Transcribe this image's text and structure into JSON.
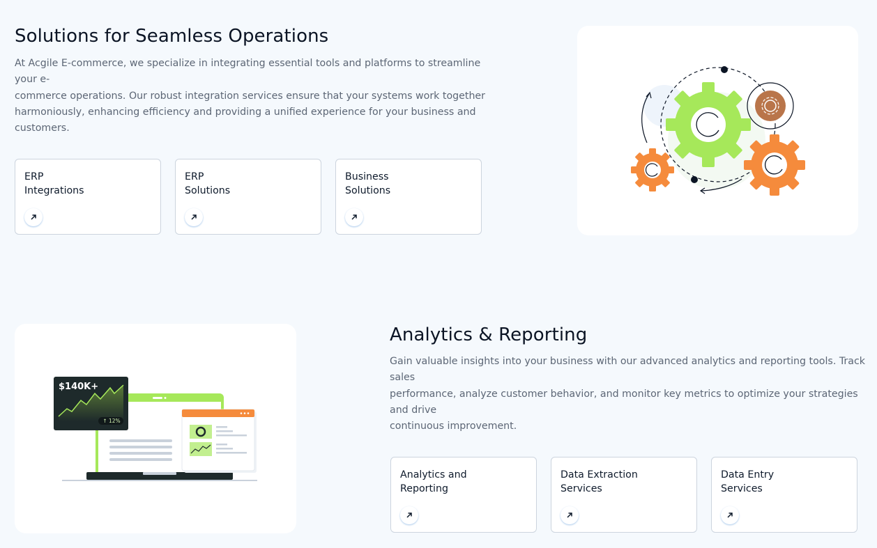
{
  "section1": {
    "title": "Solutions for Seamless Operations",
    "description_lines": [
      "At Acgile E-commerce, we specialize in integrating essential tools and platforms to streamline your e-",
      "commerce operations. Our robust integration services ensure that your systems work together",
      "harmoniously, enhancing efficiency and providing a unified experience for your business and customers."
    ],
    "cards": [
      {
        "line1": "ERP",
        "line2": "Integrations"
      },
      {
        "line1": "ERP",
        "line2": "Solutions"
      },
      {
        "line1": "Business",
        "line2": "Solutions"
      }
    ]
  },
  "section2": {
    "title": "Analytics & Reporting",
    "description_lines": [
      "Gain valuable insights into your business with our advanced analytics and reporting tools. Track sales",
      "performance, analyze customer behavior, and monitor key metrics to optimize your strategies and drive",
      "continuous improvement."
    ],
    "cards": [
      {
        "line1": "Analytics and",
        "line2": "Reporting"
      },
      {
        "line1": "Data Extraction",
        "line2": "Services"
      },
      {
        "line1": "Data Entry",
        "line2": "Services"
      }
    ],
    "illustration": {
      "stat_value": "$140K+",
      "stat_change": "↑ 12%"
    }
  },
  "icons": {
    "card_arrow": "arrow-up-right-icon"
  },
  "colors": {
    "green": "#a6e85a",
    "orange": "#f58b3c",
    "brown": "#b9754a",
    "dark": "#1e2a2b",
    "card_border": "#ccd4de",
    "page_bg": "#f5f9fd"
  }
}
